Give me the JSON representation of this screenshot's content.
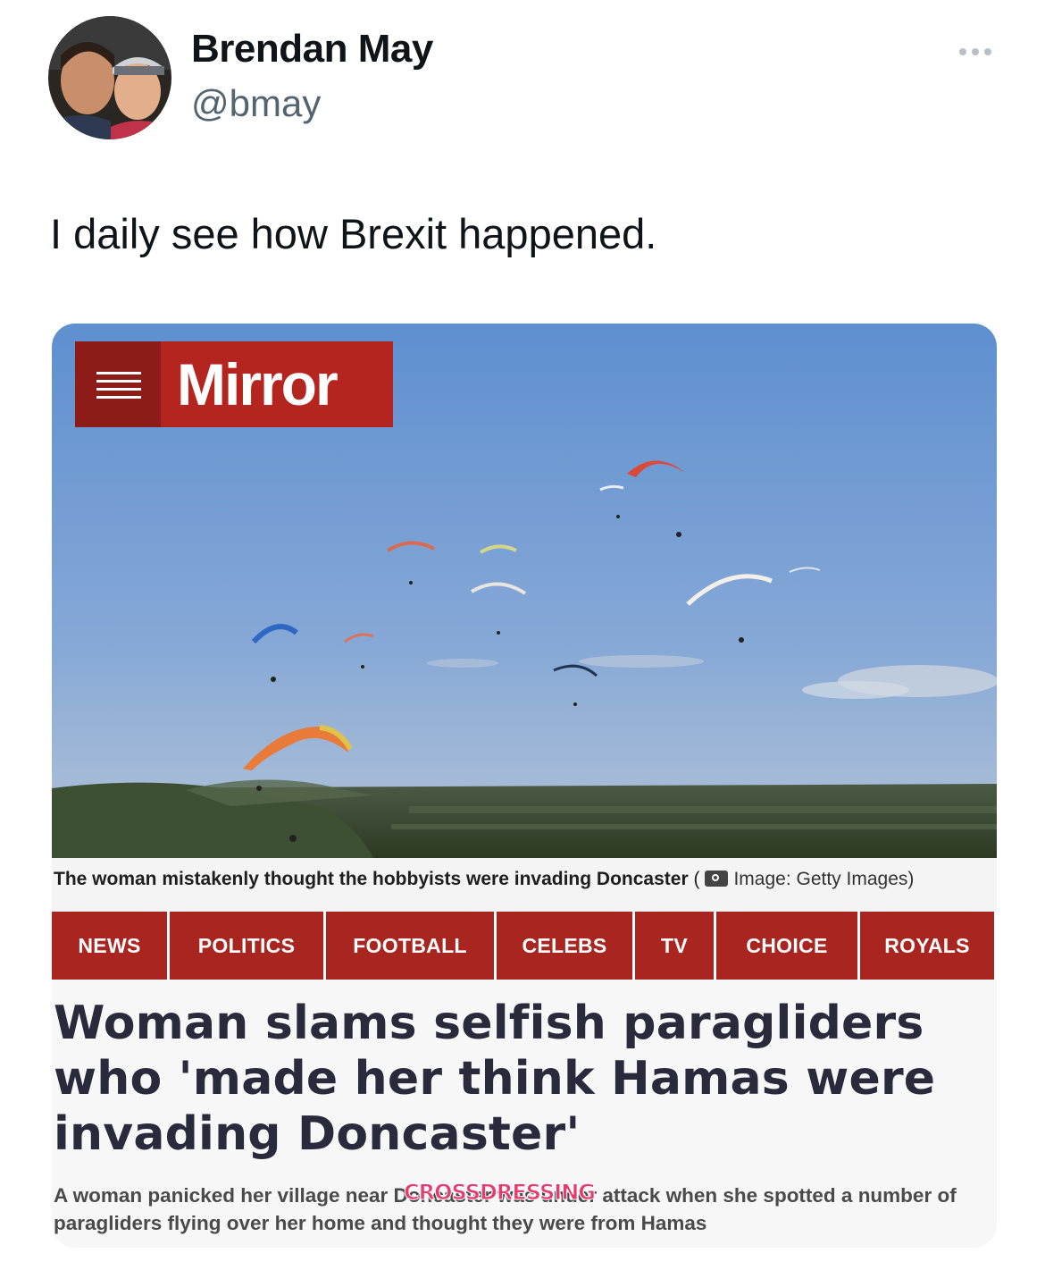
{
  "author": {
    "name": "Brendan May",
    "handle": "@bmay"
  },
  "tweet": {
    "text": "I daily see how Brexit happened."
  },
  "icons": {
    "more": "more-horizontal-icon",
    "menu": "hamburger-menu-icon",
    "camera": "camera-icon"
  },
  "article": {
    "logo": "Mirror",
    "caption": "The woman mistakenly thought the hobbyists were invading Doncaster",
    "caption_credit": "Image: Getty Images)",
    "nav": [
      "NEWS",
      "POLITICS",
      "FOOTBALL",
      "CELEBS",
      "TV",
      "CHOICE",
      "ROYALS"
    ],
    "headline": "Woman slams selfish paragliders who 'made her think Hamas were invading Doncaster'",
    "standfirst": "A woman panicked her village near Doncaster was under attack when she spotted a number of paragliders flying over her home and thought they were from Hamas"
  },
  "watermark": "CROSSDRESSING",
  "colors": {
    "brand_red": "#a92620",
    "logo_dark": "#8d1c18",
    "headline": "#2b2a3d",
    "handle_gray": "#536471",
    "watermark_pink": "#e73a6d"
  }
}
